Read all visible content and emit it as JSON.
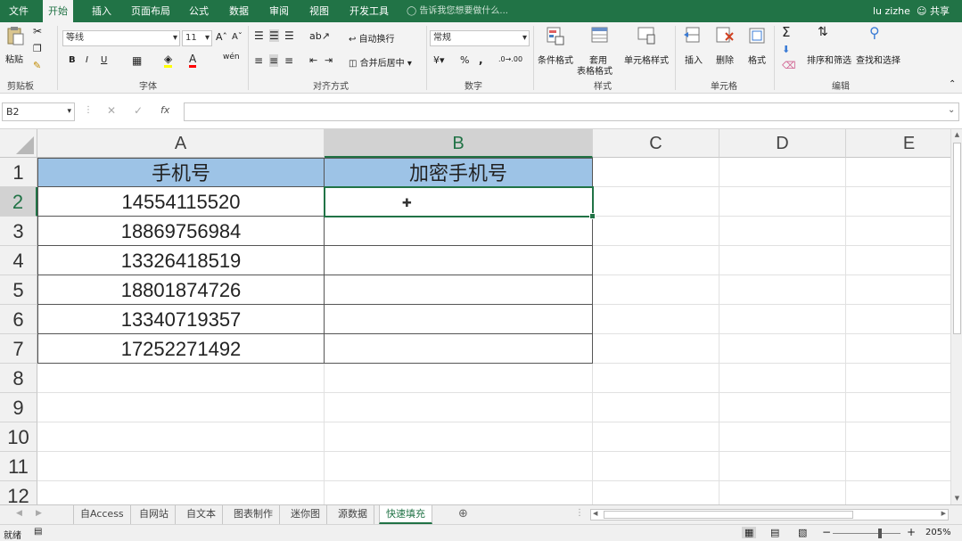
{
  "ribbon_tabs": [
    "文件",
    "开始",
    "插入",
    "页面布局",
    "公式",
    "数据",
    "审阅",
    "视图",
    "开发工具"
  ],
  "active_tab": "开始",
  "tell_me": "告诉我您想要做什么...",
  "user": "lu zizhe",
  "share": "共享",
  "clipboard": {
    "paste": "粘贴",
    "label": "剪贴板"
  },
  "font": {
    "name": "等线",
    "size": "11",
    "bold": "B",
    "italic": "I",
    "underline": "U",
    "label": "字体"
  },
  "alignment": {
    "wrap": "自动换行",
    "merge": "合并后居中",
    "label": "对齐方式"
  },
  "number": {
    "format": "常规",
    "percent": "%",
    "comma": ",",
    "label": "数字"
  },
  "styles": {
    "conditional": "条件格式",
    "table_format_1": "套用",
    "table_format_2": "表格格式",
    "cell_styles": "单元格样式",
    "label": "样式"
  },
  "cells": {
    "insert": "插入",
    "delete": "删除",
    "format": "格式",
    "label": "单元格"
  },
  "editing": {
    "sort": "排序和筛选",
    "find": "查找和选择",
    "label": "编辑"
  },
  "namebox": "B2",
  "fx": "fx",
  "columns": [
    "A",
    "B",
    "C",
    "D",
    "E"
  ],
  "selected_column": "B",
  "rows": [
    "1",
    "2",
    "3",
    "4",
    "5",
    "6",
    "7",
    "8",
    "9",
    "10",
    "11",
    "12"
  ],
  "selected_row": "2",
  "table": {
    "header_a": "手机号",
    "header_b": "加密手机号",
    "phones": [
      "14554115520",
      "18869756984",
      "13326418519",
      "18801874726",
      "13340719357",
      "17252271492"
    ]
  },
  "sheets": [
    "自Access",
    "自网站",
    "自文本",
    "图表制作",
    "迷你图",
    "源数据",
    "快速填充"
  ],
  "active_sheet": "快速填充",
  "status": {
    "ready": "就绪",
    "zoom": "205%"
  },
  "colors": {
    "accent": "#217346",
    "header_fill": "#9dc3e6"
  }
}
